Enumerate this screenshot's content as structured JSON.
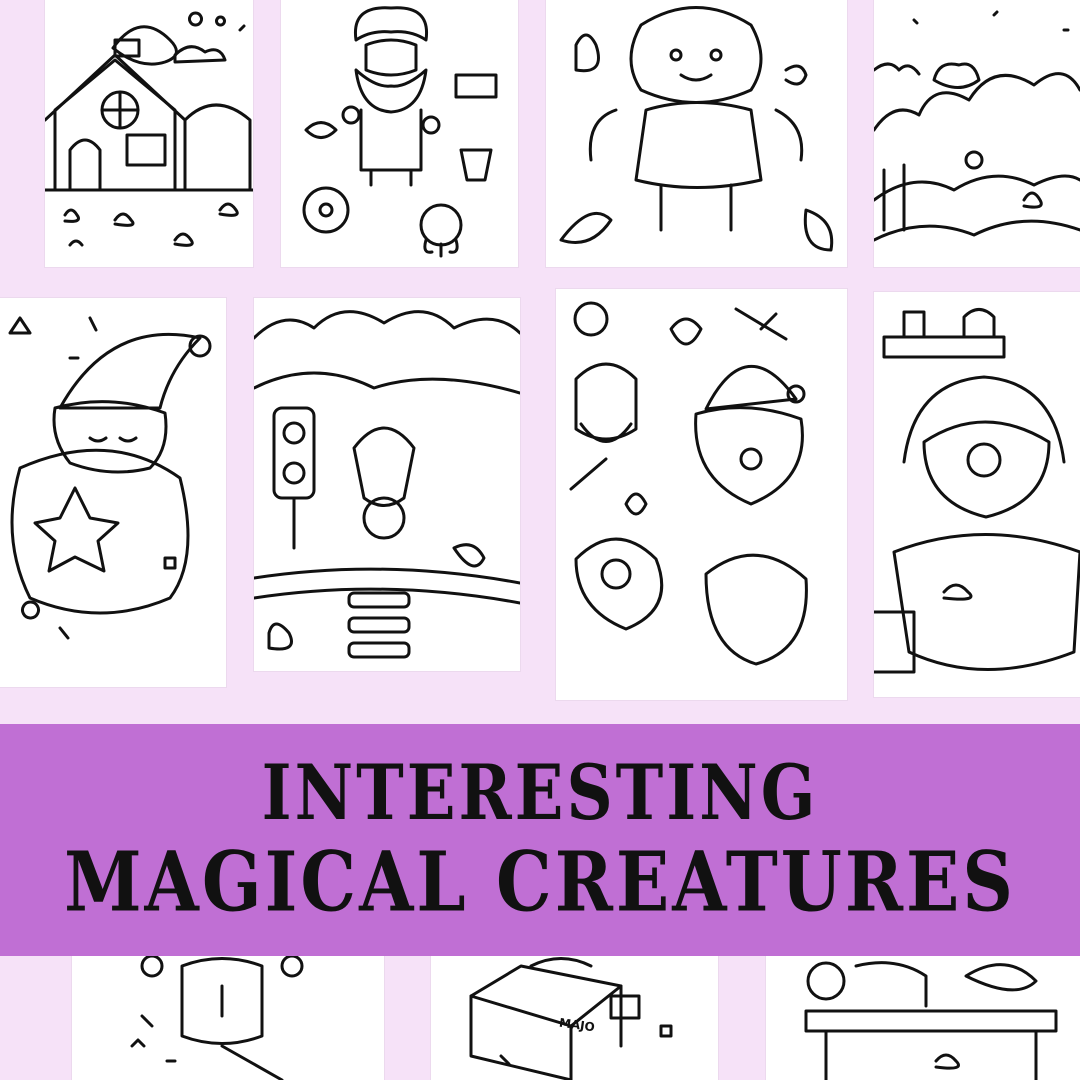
{
  "banner": {
    "line1": "INTERESTING",
    "line2": "MAGICAL CREATURES",
    "background_color": "#c06fd4",
    "text_color": "#111111"
  },
  "page_background_color": "#f6e2f8",
  "pages": [
    {
      "id": "house-scene",
      "icon": "house-with-cat-icon"
    },
    {
      "id": "bearded-gnome-scene",
      "icon": "bearded-gnome-icon"
    },
    {
      "id": "teapot-girl-scene",
      "icon": "teapot-girl-icon"
    },
    {
      "id": "cloud-landscape-scene",
      "icon": "cloud-landscape-icon"
    },
    {
      "id": "sleeping-wizard-scene",
      "icon": "sleeping-wizard-icon"
    },
    {
      "id": "forest-crossing-scene",
      "icon": "forest-crossing-icon"
    },
    {
      "id": "character-sticker-sheet",
      "icon": "character-stickers-icon"
    },
    {
      "id": "cauldron-witch-scene",
      "icon": "cauldron-witch-icon"
    },
    {
      "id": "bottom-left-scene",
      "icon": "broom-character-icon"
    },
    {
      "id": "bottom-middle-scene",
      "icon": "parcel-box-icon"
    },
    {
      "id": "bottom-right-scene",
      "icon": "shop-counter-icon"
    }
  ],
  "parcel_label": "MAJO"
}
